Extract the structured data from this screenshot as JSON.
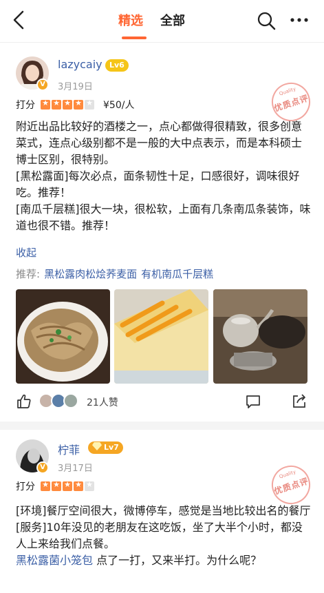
{
  "header": {
    "tabs": [
      {
        "label": "精选",
        "active": true
      },
      {
        "label": "全部",
        "active": false
      }
    ],
    "accent_color": "#ff6633"
  },
  "reviews": [
    {
      "username": "lazycaiy",
      "level": "Lv6",
      "date": "3月19日",
      "score_label": "打分",
      "stars": 4,
      "price": "¥50/人",
      "quality_stamp": "优质点评",
      "quality_stamp_sub": "Quality",
      "paragraphs": [
        "附近出品比较好的酒楼之一，点心都做得很精致，很多创意菜式，连点心级别都不是一般的大中点表示，而是本科硕士博士区别，很特别。",
        "[黑松露面]每次必点，面条韧性十足，口感很好，调味很好吃。推荐！",
        "[南瓜千层糕]很大一块，很松软，上面有几条南瓜条装饰，味道也很不错。推荐！"
      ],
      "collapse_label": "收起",
      "recommend_label": "推荐:",
      "recommended_dishes": [
        "黑松露肉松烩荞麦面",
        "有机南瓜千层糕"
      ],
      "likes": "21人赞"
    },
    {
      "username": "柠菲",
      "level": "Lv7",
      "date": "3月17日",
      "score_label": "打分",
      "stars": 4,
      "quality_stamp": "优质点评",
      "quality_stamp_sub": "Quality",
      "paragraphs": [
        "[环境]餐厅空间很大，微博停车，感觉是当地比较出名的餐厅",
        "[服务]10年没见的老朋友在这吃饭，坐了大半个小时，都没人上来给我们点餐。"
      ],
      "dish_link": "黑松露菌小笼包",
      "last_line_rest": " 点了一打，又来半打。为什么呢？"
    }
  ],
  "icons": [
    "back-arrow-icon",
    "search-icon",
    "more-icon",
    "like-icon",
    "comment-icon",
    "share-icon"
  ]
}
